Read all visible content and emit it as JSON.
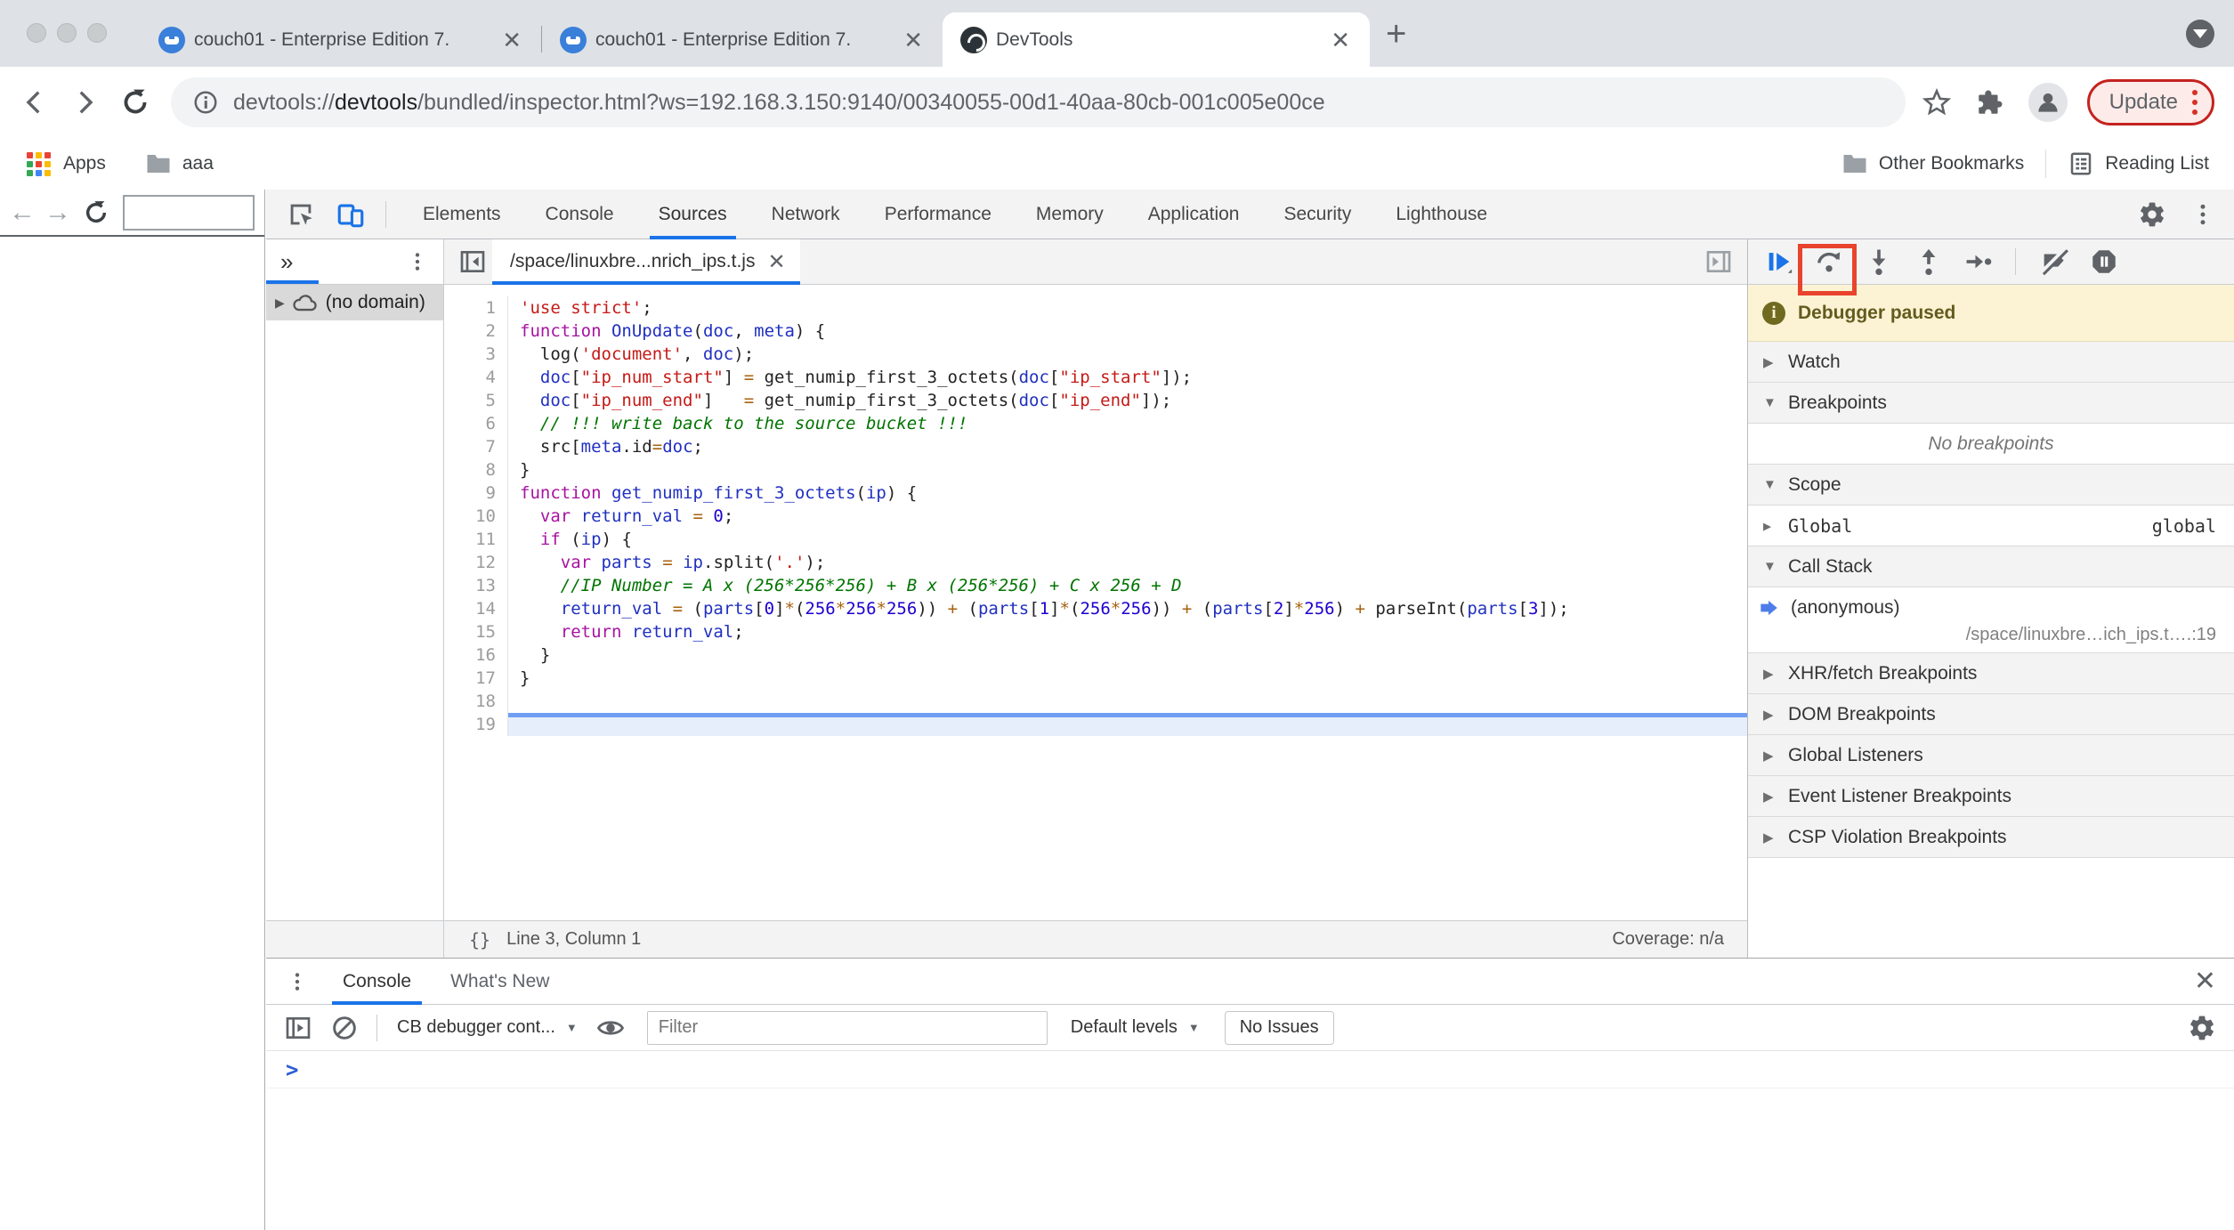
{
  "browser": {
    "tabs": [
      {
        "title": "couch01 - Enterprise Edition 7.",
        "favicon": "couchbase-icon"
      },
      {
        "title": "couch01 - Enterprise Edition 7.",
        "favicon": "couchbase-icon"
      },
      {
        "title": "DevTools",
        "favicon": "devtools-icon",
        "active": true
      }
    ],
    "url": {
      "scheme": "devtools://",
      "host": "devtools",
      "rest": "/bundled/inspector.html?ws=192.168.3.150:9140/00340055-00d1-40aa-80cb-001c005e00ce"
    },
    "update_label": "Update",
    "bookmarks": {
      "apps": "Apps",
      "folder": "aaa",
      "other": "Other Bookmarks",
      "reading": "Reading List"
    },
    "apps_grid_colors": [
      "#ea4335",
      "#fbbc04",
      "#ea4335",
      "#34a853",
      "#ea4335",
      "#fbbc04",
      "#34a853",
      "#4285f4",
      "#fbbc04"
    ]
  },
  "devtools": {
    "tabs": [
      "Elements",
      "Console",
      "Sources",
      "Network",
      "Performance",
      "Memory",
      "Application",
      "Security",
      "Lighthouse"
    ],
    "active_tab": "Sources",
    "sources": {
      "more_tabs": "»",
      "tree_item": "(no domain)",
      "file_tab": "/space/linuxbre...nrich_ips.t.js",
      "status_line": "Line 3, Column 1",
      "status_coverage": "Coverage: n/a",
      "braces": "{}",
      "code": {
        "highlight_line": 19,
        "lines": [
          {
            "n": 1,
            "t": [
              [
                "s",
                "'use strict'"
              ],
              [
                "p",
                ";"
              ]
            ]
          },
          {
            "n": 2,
            "t": [
              [
                "k",
                "function"
              ],
              [
                "p",
                " "
              ],
              [
                "v",
                "OnUpdate"
              ],
              [
                "p",
                "("
              ],
              [
                "v",
                "doc"
              ],
              [
                "p",
                ", "
              ],
              [
                "v",
                "meta"
              ],
              [
                "p",
                ") {"
              ]
            ]
          },
          {
            "n": 3,
            "t": [
              [
                "p",
                "  log("
              ],
              [
                "s",
                "'document'"
              ],
              [
                "p",
                ", "
              ],
              [
                "v",
                "doc"
              ],
              [
                "p",
                ");"
              ]
            ]
          },
          {
            "n": 4,
            "t": [
              [
                "p",
                "  "
              ],
              [
                "v",
                "doc"
              ],
              [
                "p",
                "["
              ],
              [
                "s",
                "\"ip_num_start\""
              ],
              [
                "p",
                "] "
              ],
              [
                "o",
                "="
              ],
              [
                "p",
                " get_numip_first_3_octets("
              ],
              [
                "v",
                "doc"
              ],
              [
                "p",
                "["
              ],
              [
                "s",
                "\"ip_start\""
              ],
              [
                "p",
                "]);"
              ]
            ]
          },
          {
            "n": 5,
            "t": [
              [
                "p",
                "  "
              ],
              [
                "v",
                "doc"
              ],
              [
                "p",
                "["
              ],
              [
                "s",
                "\"ip_num_end\""
              ],
              [
                "p",
                "]   "
              ],
              [
                "o",
                "="
              ],
              [
                "p",
                " get_numip_first_3_octets("
              ],
              [
                "v",
                "doc"
              ],
              [
                "p",
                "["
              ],
              [
                "s",
                "\"ip_end\""
              ],
              [
                "p",
                "]);"
              ]
            ]
          },
          {
            "n": 6,
            "t": [
              [
                "p",
                "  "
              ],
              [
                "c",
                "// !!! write back to the source bucket !!!"
              ]
            ]
          },
          {
            "n": 7,
            "t": [
              [
                "p",
                "  src["
              ],
              [
                "v",
                "meta"
              ],
              [
                "p",
                ".id"
              ],
              [
                "o",
                "="
              ],
              [
                "v",
                "doc"
              ],
              [
                "p",
                ";"
              ]
            ]
          },
          {
            "n": 8,
            "t": [
              [
                "p",
                "}"
              ]
            ]
          },
          {
            "n": 9,
            "t": [
              [
                "k",
                "function"
              ],
              [
                "p",
                " "
              ],
              [
                "v",
                "get_numip_first_3_octets"
              ],
              [
                "p",
                "("
              ],
              [
                "v",
                "ip"
              ],
              [
                "p",
                ") {"
              ]
            ]
          },
          {
            "n": 10,
            "t": [
              [
                "p",
                "  "
              ],
              [
                "k",
                "var"
              ],
              [
                "p",
                " "
              ],
              [
                "v",
                "return_val"
              ],
              [
                "p",
                " "
              ],
              [
                "o",
                "="
              ],
              [
                "p",
                " "
              ],
              [
                "n",
                "0"
              ],
              [
                "p",
                ";"
              ]
            ]
          },
          {
            "n": 11,
            "t": [
              [
                "p",
                "  "
              ],
              [
                "k",
                "if"
              ],
              [
                "p",
                " ("
              ],
              [
                "v",
                "ip"
              ],
              [
                "p",
                ") {"
              ]
            ]
          },
          {
            "n": 12,
            "t": [
              [
                "p",
                "    "
              ],
              [
                "k",
                "var"
              ],
              [
                "p",
                " "
              ],
              [
                "v",
                "parts"
              ],
              [
                "p",
                " "
              ],
              [
                "o",
                "="
              ],
              [
                "p",
                " "
              ],
              [
                "v",
                "ip"
              ],
              [
                "p",
                ".split("
              ],
              [
                "s",
                "'.'"
              ],
              [
                "p",
                ");"
              ]
            ]
          },
          {
            "n": 13,
            "t": [
              [
                "p",
                "    "
              ],
              [
                "c",
                "//IP Number = A x (256*256*256) + B x (256*256) + C x 256 + D"
              ]
            ]
          },
          {
            "n": 14,
            "t": [
              [
                "p",
                "    "
              ],
              [
                "v",
                "return_val"
              ],
              [
                "p",
                " "
              ],
              [
                "o",
                "="
              ],
              [
                "p",
                " ("
              ],
              [
                "v",
                "parts"
              ],
              [
                "p",
                "["
              ],
              [
                "n",
                "0"
              ],
              [
                "p",
                "]"
              ],
              [
                "o",
                "*"
              ],
              [
                "p",
                "("
              ],
              [
                "n",
                "256"
              ],
              [
                "o",
                "*"
              ],
              [
                "n",
                "256"
              ],
              [
                "o",
                "*"
              ],
              [
                "n",
                "256"
              ],
              [
                "p",
                ")) "
              ],
              [
                "o",
                "+"
              ],
              [
                "p",
                " ("
              ],
              [
                "v",
                "parts"
              ],
              [
                "p",
                "["
              ],
              [
                "n",
                "1"
              ],
              [
                "p",
                "]"
              ],
              [
                "o",
                "*"
              ],
              [
                "p",
                "("
              ],
              [
                "n",
                "256"
              ],
              [
                "o",
                "*"
              ],
              [
                "n",
                "256"
              ],
              [
                "p",
                ")) "
              ],
              [
                "o",
                "+"
              ],
              [
                "p",
                " ("
              ],
              [
                "v",
                "parts"
              ],
              [
                "p",
                "["
              ],
              [
                "n",
                "2"
              ],
              [
                "p",
                "]"
              ],
              [
                "o",
                "*"
              ],
              [
                "n",
                "256"
              ],
              [
                "p",
                ") "
              ],
              [
                "o",
                "+"
              ],
              [
                "p",
                " parseInt("
              ],
              [
                "v",
                "parts"
              ],
              [
                "p",
                "["
              ],
              [
                "n",
                "3"
              ],
              [
                "p",
                "]);"
              ]
            ]
          },
          {
            "n": 15,
            "t": [
              [
                "p",
                "    "
              ],
              [
                "k",
                "return"
              ],
              [
                "p",
                " "
              ],
              [
                "v",
                "return_val"
              ],
              [
                "p",
                ";"
              ]
            ]
          },
          {
            "n": 16,
            "t": [
              [
                "p",
                "  }"
              ]
            ]
          },
          {
            "n": 17,
            "t": [
              [
                "p",
                "}"
              ]
            ]
          },
          {
            "n": 18,
            "t": []
          },
          {
            "n": 19,
            "t": []
          }
        ]
      }
    },
    "debugger": {
      "paused": "Debugger paused",
      "watch": "Watch",
      "breakpoints": "Breakpoints",
      "no_breakpoints": "No breakpoints",
      "scope": "Scope",
      "scope_name": "Global",
      "scope_value": "global",
      "call_stack": "Call Stack",
      "frame_name": "(anonymous)",
      "frame_location": "/space/linuxbre…ich_ips.t….:19",
      "xhr": "XHR/fetch Breakpoints",
      "dom": "DOM Breakpoints",
      "global_listeners": "Global Listeners",
      "event_listener": "Event Listener Breakpoints",
      "csp": "CSP Violation Breakpoints"
    },
    "console": {
      "tab_console": "Console",
      "tab_whats_new": "What's New",
      "context": "CB debugger cont...",
      "filter_placeholder": "Filter",
      "levels": "Default levels",
      "no_issues": "No Issues",
      "prompt": ">"
    }
  },
  "colors": {
    "accent": "#1a73e8",
    "annotation": "#e8432e",
    "paused_bg": "#fbf3d3",
    "exec_line": "#6f9ef3"
  }
}
